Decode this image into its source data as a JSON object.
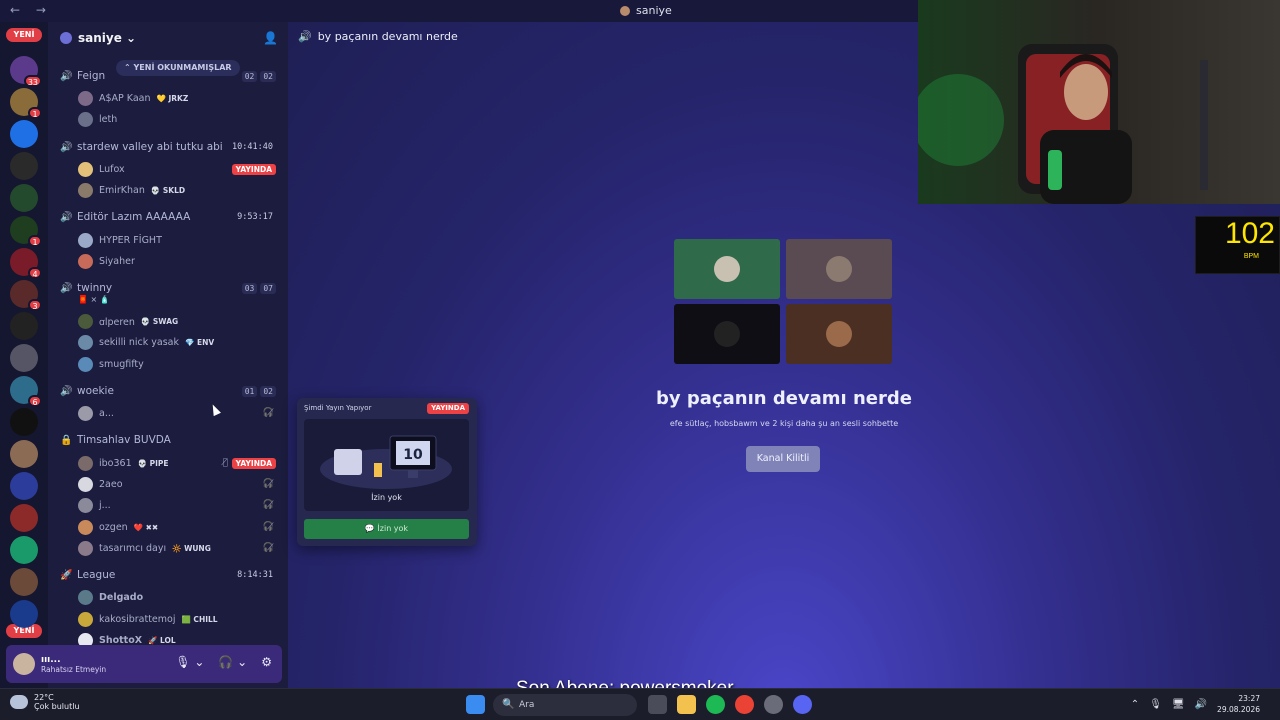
{
  "titlebar": {
    "title": "saniye",
    "nav": "← →"
  },
  "guilds": [
    {
      "color": "#5b3a8c",
      "badge": "33"
    },
    {
      "color": "#8a6b3a",
      "badge": "1"
    },
    {
      "color": "#1f6fe5",
      "badge": ""
    },
    {
      "color": "#2a2a2a",
      "badge": ""
    },
    {
      "color": "#234a2c",
      "badge": ""
    },
    {
      "color": "#1f3d1f",
      "badge": "1"
    },
    {
      "color": "#7a1b2a",
      "badge": "4"
    },
    {
      "color": "#5a2a2a",
      "badge": "3"
    },
    {
      "color": "#222",
      "badge": ""
    },
    {
      "color": "#556",
      "badge": ""
    },
    {
      "color": "#2e6c8c",
      "badge": "6"
    },
    {
      "color": "#111",
      "badge": ""
    },
    {
      "color": "#8c6b55",
      "badge": ""
    },
    {
      "color": "#2b3c9a",
      "badge": ""
    },
    {
      "color": "#8c2a2a",
      "badge": ""
    },
    {
      "color": "#1a9a6a",
      "badge": ""
    },
    {
      "color": "#6b4a3a",
      "badge": ""
    },
    {
      "color": "#1a3a8c",
      "badge": ""
    }
  ],
  "guild_new_label": "YENİ",
  "server": {
    "name": "saniye ⌄",
    "unread_pill": "⌃ YENİ OKUNMAMIŞLAR"
  },
  "voice_channels": [
    {
      "name": "Feign",
      "meta_a": "02",
      "meta_b": "02",
      "time": ""
    },
    {
      "name": "stardew valley abi tutku abi",
      "meta_a": "",
      "meta_b": "",
      "time": "10:41:40"
    },
    {
      "name": "Editör Lazım AAAAAA",
      "meta_a": "",
      "meta_b": "",
      "time": "9:53:17"
    },
    {
      "name": "twinny",
      "meta_a": "03",
      "meta_b": "07",
      "time": ""
    },
    {
      "name": "woekie",
      "meta_a": "01",
      "meta_b": "02",
      "time": ""
    },
    {
      "name": "Timsahlav BUVDA",
      "meta_a": "",
      "meta_b": "",
      "time": ""
    },
    {
      "name": "League",
      "meta_a": "",
      "meta_b": "",
      "time": "8:14:31"
    }
  ],
  "users": [
    {
      "name": "A$AP Kaan",
      "tag": "💛 JRKZ",
      "color": "#7d6a88"
    },
    {
      "name": "leth",
      "tag": "",
      "color": "#6a6f8a"
    },
    {
      "name": "Lufox",
      "tag": "",
      "color": "#e2c07a"
    },
    {
      "name": "EmirKhan",
      "tag": "💀 SKLD",
      "color": "#8a7a6a"
    },
    {
      "name": "HYPER FİGHT",
      "tag": "",
      "color": "#9aa9c8"
    },
    {
      "name": "Siyaher",
      "tag": "",
      "color": "#c86a5a"
    },
    {
      "name": "ꭤlperen",
      "tag": "💀 SWAG",
      "color": "#4a5a3a"
    },
    {
      "name": "sekilli nick yasak",
      "tag": "💎 ENV",
      "color": "#6a8aa8"
    },
    {
      "name": "smugfifty",
      "tag": "",
      "color": "#5a8ab8"
    },
    {
      "name": "a...",
      "tag": "",
      "color": "#9a9aa8"
    },
    {
      "name": "ibo361",
      "tag": "💀 PIPE",
      "color": "#7a6a6a"
    },
    {
      "name": "2aeo",
      "tag": "",
      "color": "#d8d8e0"
    },
    {
      "name": "j...",
      "tag": "",
      "color": "#8a8a9a"
    },
    {
      "name": "ozgen",
      "tag": "❤️ ✖✖",
      "color": "#c88a5a"
    },
    {
      "name": "tasarımcı dayı",
      "tag": "🔆 WUNG",
      "color": "#8a7a8a"
    },
    {
      "name": "Delgado",
      "tag": "",
      "color": "#5a7a8a"
    },
    {
      "name": "kakosibrattemoj",
      "tag": "🟩 CHILL",
      "color": "#c8a83a"
    },
    {
      "name": "ShottoX",
      "tag": "🚀 LOL",
      "color": "#e8e8f0"
    }
  ],
  "twinny_sub": "🧧 × 🧴",
  "live_label": "YAYINDA",
  "me": {
    "name": "ııı...",
    "status": "Rahatsız Etmeyin"
  },
  "main": {
    "channel_title": "by paçanın devamı nerde",
    "stage_title": "by paçanın devamı nerde",
    "stage_sub": "efe sütlaç, hobsbawm ve 2 kişi daha şu an sesli sohbette",
    "locked_label": "Kanal Kilitli",
    "tiles": [
      "#2f6b4a",
      "#5a4a52",
      "#0e0e14",
      "#4a2f22"
    ]
  },
  "popup": {
    "header": "Şimdi Yayın Yapıyor",
    "live": "YAYINDA",
    "art_number": "10",
    "caption": "İzin yok",
    "button": "💬 İzin yok"
  },
  "bpm": {
    "value": "102",
    "label": "BPM"
  },
  "overlay_text": "Son Abone: powersmoker",
  "taskbar": {
    "temp": "22°C",
    "weather": "Çok bulutlu",
    "search": "Ara",
    "time": "23:27",
    "date": "29.08.2026"
  }
}
